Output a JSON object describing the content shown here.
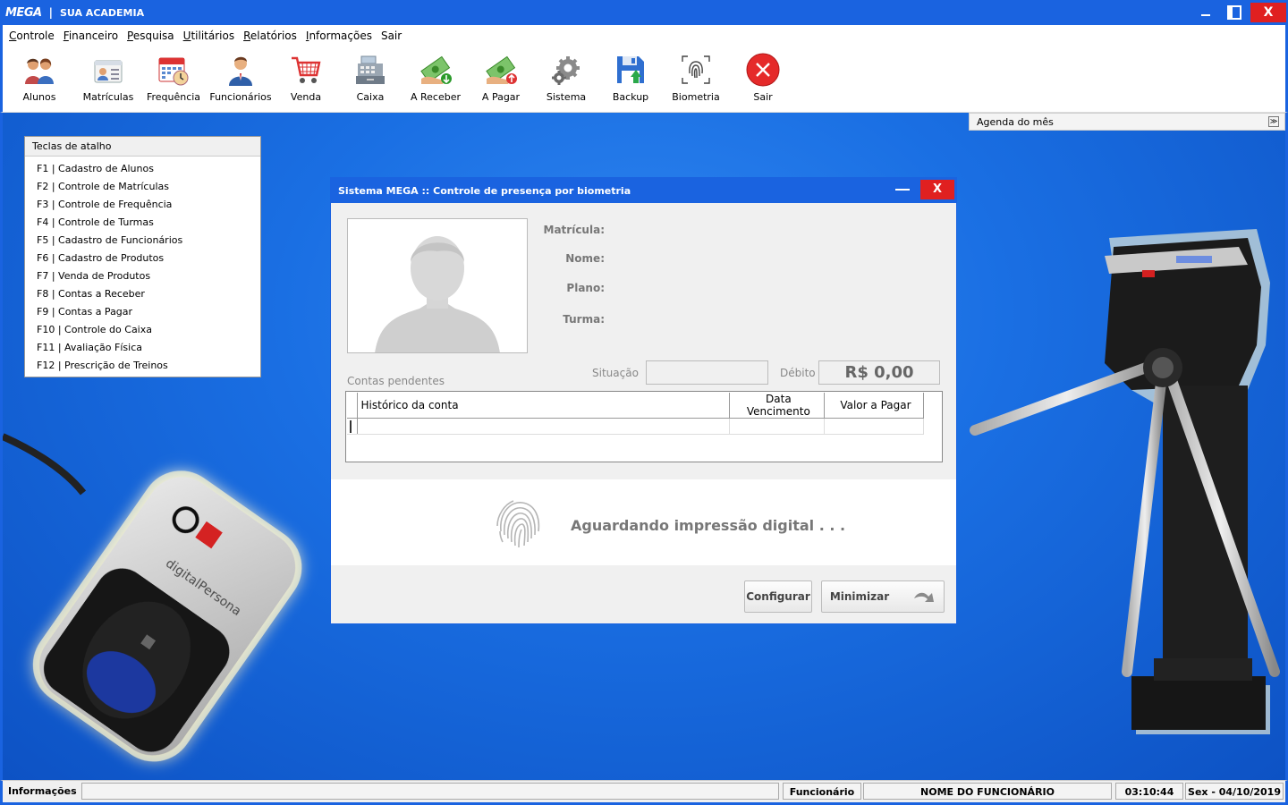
{
  "window": {
    "logo": "MEGA",
    "separator": "|",
    "title": "SUA ACADEMIA",
    "close_label": "X"
  },
  "menu": [
    {
      "label": "Controle",
      "underline": "C",
      "rest": "ontrole"
    },
    {
      "label": "Financeiro",
      "underline": "F",
      "rest": "inanceiro"
    },
    {
      "label": "Pesquisa",
      "underline": "P",
      "rest": "esquisa"
    },
    {
      "label": "Utilitários",
      "underline": "U",
      "rest": "tilitários"
    },
    {
      "label": "Relatórios",
      "underline": "R",
      "rest": "elatórios"
    },
    {
      "label": "Informações",
      "underline": "I",
      "rest": "nformações"
    },
    {
      "label": "Sair",
      "underline": "",
      "rest": "Sair"
    }
  ],
  "toolbar": [
    {
      "label": "Alunos",
      "icon": "students-icon"
    },
    {
      "label": "Matrículas",
      "icon": "enrollment-card-icon"
    },
    {
      "label": "Frequência",
      "icon": "calendar-clock-icon"
    },
    {
      "label": "Funcionários",
      "icon": "employee-icon"
    },
    {
      "label": "Venda",
      "icon": "shopping-cart-icon"
    },
    {
      "label": "Caixa",
      "icon": "cash-register-icon"
    },
    {
      "label": "A Receber",
      "icon": "money-receive-icon"
    },
    {
      "label": "A Pagar",
      "icon": "money-pay-icon"
    },
    {
      "label": "Sistema",
      "icon": "gears-icon"
    },
    {
      "label": "Backup",
      "icon": "floppy-disk-icon"
    },
    {
      "label": "Biometria",
      "icon": "fingerprint-icon"
    },
    {
      "label": "Sair",
      "icon": "exit-icon"
    }
  ],
  "agenda": {
    "label": "Agenda do mês",
    "toggle": "≫"
  },
  "shortcuts": {
    "title": "Teclas de atalho",
    "items": [
      "F1 | Cadastro de Alunos",
      "F2 | Controle de Matrículas",
      "F3 | Controle de Frequência",
      "F4 | Controle de Turmas",
      "F5 | Cadastro de Funcionários",
      "F6 | Cadastro de Produtos",
      "F7 | Venda de Produtos",
      "F8 | Contas a Receber",
      "F9 | Contas a Pagar",
      "F10 | Controle do Caixa",
      "F11 | Avaliação Física",
      "F12 | Prescrição de Treinos"
    ]
  },
  "dialog": {
    "title": "Sistema MEGA :: Controle de presença por biometria",
    "close_label": "X",
    "fields": {
      "matricula": "Matrícula:",
      "nome": "Nome:",
      "plano": "Plano:",
      "turma": "Turma:"
    },
    "situacao_label": "Situação",
    "situacao_value": "",
    "debito_label": "Débito",
    "debito_value": "R$ 0,00",
    "contas_label": "Contas pendentes",
    "table_headers": [
      "Histórico da conta",
      "Data Vencimento",
      "Valor a Pagar"
    ],
    "waiting_text": "Aguardando impressão digital . . .",
    "configurar_label": "Configurar",
    "minimizar_label": "Minimizar"
  },
  "statusbar": {
    "info_label": "Informações",
    "info_value": "",
    "employee_label": "Funcionário",
    "employee_name": "NOME DO FUNCIONÁRIO",
    "time": "03:10:44",
    "date": "Sex - 04/10/2019"
  },
  "colors": {
    "titlebar": "#1a63e0",
    "close_red": "#e02020",
    "desktop_blue": "#1a6fe3"
  }
}
